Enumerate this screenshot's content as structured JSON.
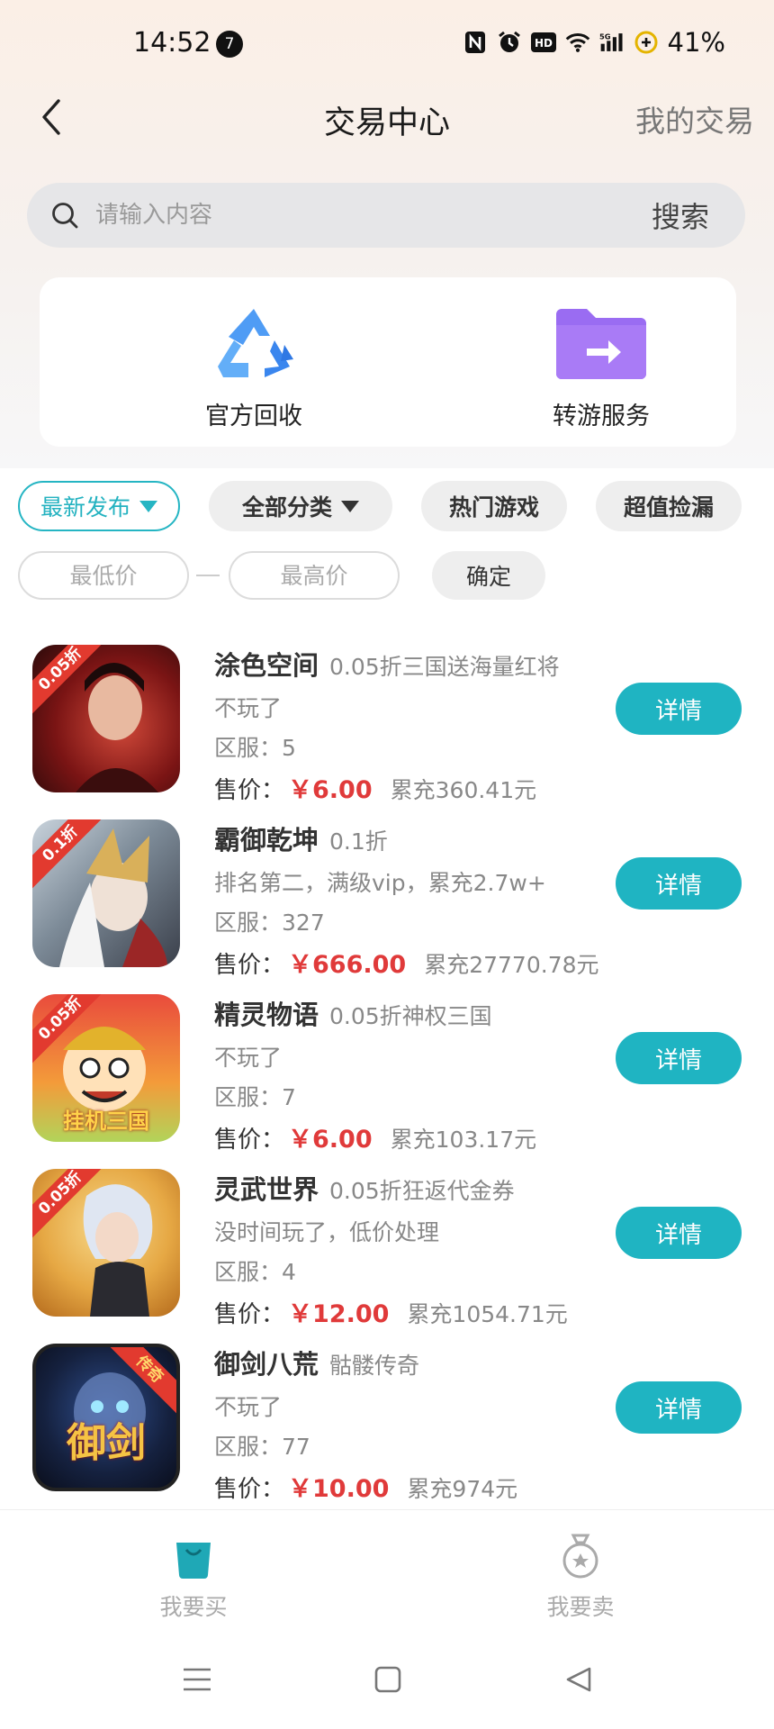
{
  "status_bar": {
    "time": "14:52",
    "notification_count": "7",
    "battery": "41%",
    "icons": [
      "nfc-icon",
      "alarm-icon",
      "hd-icon",
      "wifi-icon",
      "signal-5g-icon",
      "battery-saver-icon"
    ]
  },
  "header": {
    "title": "交易中心",
    "my_trade": "我的交易"
  },
  "search": {
    "placeholder": "请输入内容",
    "button": "搜索"
  },
  "services": [
    {
      "label": "官方回收",
      "icon": "recycle-icon"
    },
    {
      "label": "转游服务",
      "icon": "folder-transfer-icon"
    }
  ],
  "filters": {
    "sort": "最新发布",
    "category": "全部分类",
    "hot": "热门游戏",
    "bargain": "超值捡漏",
    "min_price_placeholder": "最低价",
    "max_price_placeholder": "最高价",
    "confirm": "确定"
  },
  "items": [
    {
      "name": "涂色空间",
      "sub": "0.05折三国送海量红将",
      "desc": "不玩了",
      "server_label": "区服：",
      "server": "5",
      "price_label": "售价：",
      "price": "￥6.00",
      "recharge": "累充360.41元",
      "badge": "0.05折",
      "detail": "详情"
    },
    {
      "name": "霸御乾坤",
      "sub": "0.1折",
      "desc": "排名第二，满级vip，累充2.7w+",
      "server_label": "区服：",
      "server": "327",
      "price_label": "售价：",
      "price": "￥666.00",
      "recharge": "累充27770.78元",
      "badge": "0.1折",
      "detail": "详情"
    },
    {
      "name": "精灵物语",
      "sub": "0.05折神权三国",
      "desc": "不玩了",
      "server_label": "区服：",
      "server": "7",
      "price_label": "售价：",
      "price": "￥6.00",
      "recharge": "累充103.17元",
      "badge": "0.05折",
      "caption": "挂机三国",
      "detail": "详情"
    },
    {
      "name": "灵武世界",
      "sub": "0.05折狂返代金券",
      "desc": "没时间玩了，低价处理",
      "server_label": "区服：",
      "server": "4",
      "price_label": "售价：",
      "price": "￥12.00",
      "recharge": "累充1054.71元",
      "badge": "0.05折",
      "detail": "详情"
    },
    {
      "name": "御剑八荒",
      "sub": "骷髅传奇",
      "desc": "不玩了",
      "server_label": "区服：",
      "server": "77",
      "price_label": "售价：",
      "price": "￥10.00",
      "recharge": "累充974元",
      "badge": "传奇",
      "caption": "御剑",
      "detail": "详情"
    }
  ],
  "tabbar": {
    "buy": "我要买",
    "sell": "我要卖"
  },
  "colors": {
    "accent": "#1fb4c2",
    "price": "#e03a3a",
    "service_blue": "#3d8ef0",
    "service_purple": "#9a6cf2"
  }
}
